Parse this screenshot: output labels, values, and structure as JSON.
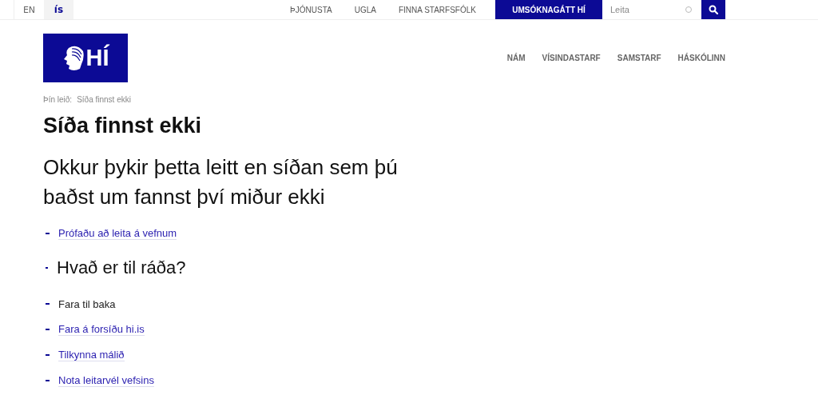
{
  "languages": [
    {
      "label": "EN",
      "selected": false
    },
    {
      "label": "ís",
      "selected": true
    }
  ],
  "top_links": [
    "ÞJÓNUSTA",
    "UGLA",
    "FINNA STARFSFÓLK"
  ],
  "apply_button": "UMSÓKNAGÁTT HÍ",
  "search": {
    "placeholder": "Leita"
  },
  "logo": {
    "text": "HÍ"
  },
  "main_nav": [
    "NÁM",
    "VÍSINDASTARF",
    "SAMSTARF",
    "HÁSKÓLINN"
  ],
  "breadcrumb": {
    "label": "Þín leið:",
    "current": "Síða finnst ekki"
  },
  "title": "Síða finnst ekki",
  "lead": "Okkur þykir þetta leitt en síðan sem þú baðst um fannst því miður ekki",
  "items": [
    {
      "kind": "link",
      "text": "Prófaðu að leita á vefnum"
    },
    {
      "kind": "heading",
      "text": "Hvað er til ráða?"
    },
    {
      "kind": "text",
      "text": "Fara til baka"
    },
    {
      "kind": "link",
      "text": "Fara á forsíðu hi.is"
    },
    {
      "kind": "link",
      "text": "Tilkynna málið"
    },
    {
      "kind": "link",
      "text": "Nota leitarvél vefsins"
    }
  ]
}
